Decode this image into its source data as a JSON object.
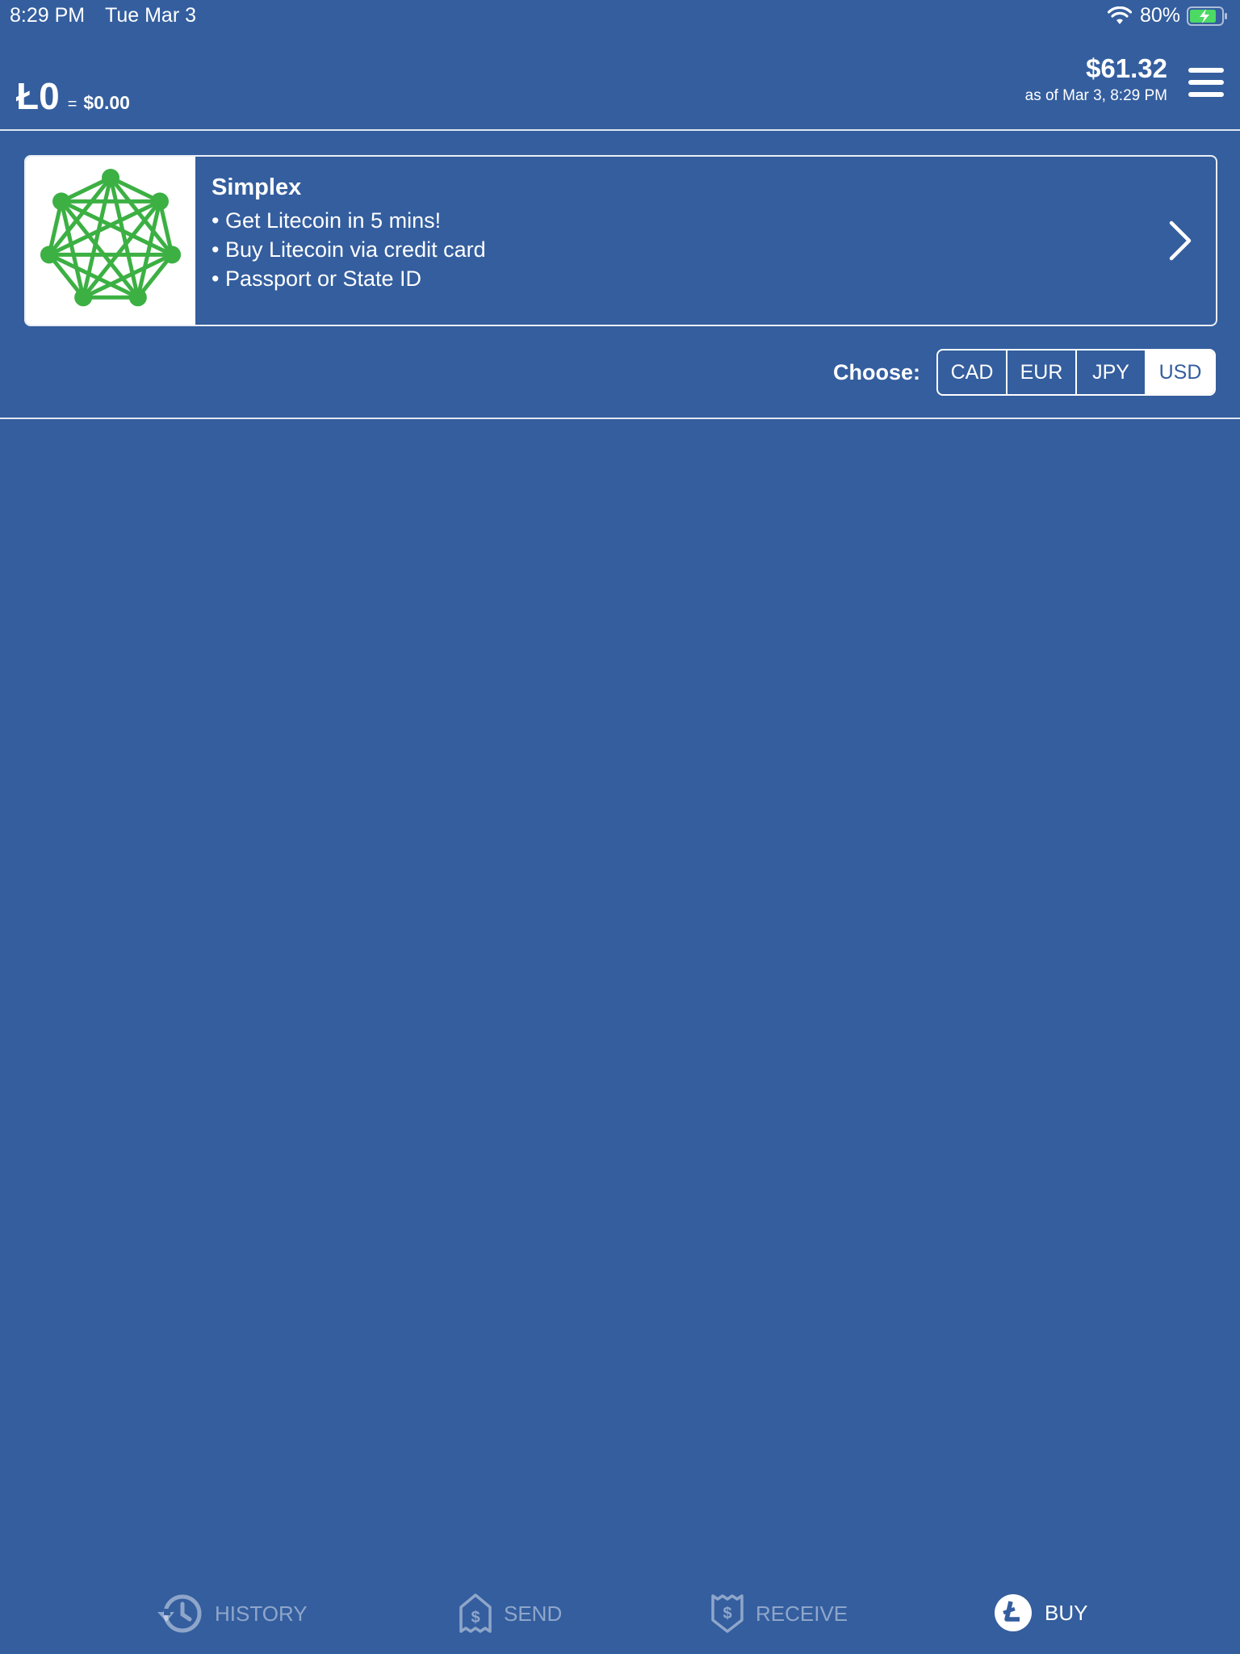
{
  "status_bar": {
    "time": "8:29 PM",
    "date": "Tue Mar 3",
    "battery": "80%"
  },
  "header": {
    "balance_ltc": "Ł0",
    "equals": "=",
    "balance_fiat": "$0.00",
    "price": "$61.32",
    "price_asof": "as of Mar 3, 8:29 PM"
  },
  "provider": {
    "name": "Simplex",
    "lines": [
      "• Get Litecoin in 5 mins!",
      "• Buy Litecoin via credit card",
      "• Passport or State ID"
    ],
    "logo_color": "#3cb043"
  },
  "chooser": {
    "label": "Choose:",
    "options": [
      "CAD",
      "EUR",
      "JPY",
      "USD"
    ],
    "selected": "USD"
  },
  "tabs": [
    {
      "label": "HISTORY",
      "icon": "history-icon"
    },
    {
      "label": "SEND",
      "icon": "send-icon"
    },
    {
      "label": "RECEIVE",
      "icon": "receive-icon"
    },
    {
      "label": "BUY",
      "icon": "litecoin-icon"
    }
  ],
  "colors": {
    "background": "#345e9e",
    "accent": "#ffffff"
  }
}
